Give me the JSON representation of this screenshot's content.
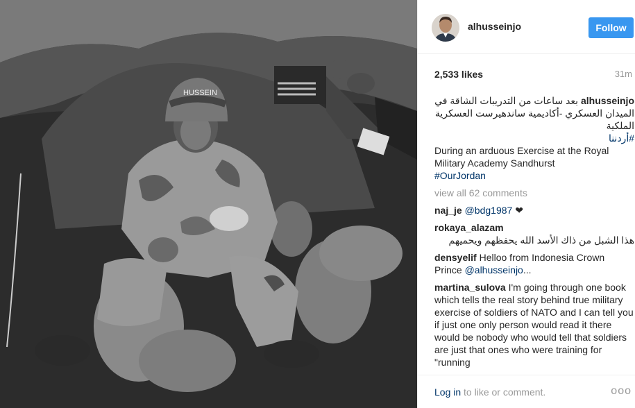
{
  "post": {
    "username": "alhusseinjo",
    "follow_label": "Follow",
    "likes": "2,533 likes",
    "time": "31m",
    "caption": {
      "username": "alhusseinjo",
      "arabic": "بعد ساعات من التدريبات الشاقة في الميدان العسكري -أكاديمية ساندهيرست العسكرية الملكية",
      "arabic_tag": "#أردننا",
      "english": "During an arduous Exercise at the Royal Military Academy Sandhurst",
      "english_tag": "#OurJordan"
    },
    "view_all": "view all 62 comments",
    "comments": [
      {
        "user": "naj_je",
        "mention": "@bdg1987",
        "text": " ❤"
      },
      {
        "user": "rokaya_alazam",
        "text": "هذا الشبل من ذاك الأسد الله يحفظهم ويحميهم"
      },
      {
        "user": "densyelif",
        "text": "Helloo from Indonesia Crown Prince ",
        "mention": "@alhusseinjo",
        "suffix": "..."
      },
      {
        "user": "martina_sulova",
        "text": "I'm going through one book which tells the real story behind true military exercise of soldiers of NATO and I can tell you if just one only person would read it there would be nobody who would tell that soldiers are just that ones who were training for \"running"
      }
    ],
    "footer": {
      "login_link": "Log in",
      "login_text": " to like or comment.",
      "more_icon": "ooo"
    },
    "photo_helmet_text": "HUSSEIN"
  }
}
